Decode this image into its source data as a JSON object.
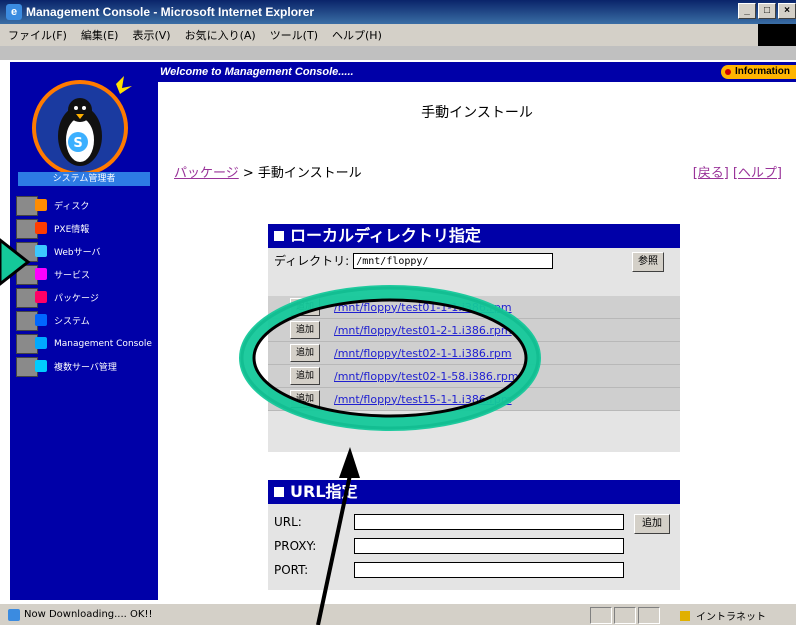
{
  "window": {
    "title": "Management Console - Microsoft Internet Explorer",
    "controls": [
      "_",
      "□",
      "×"
    ]
  },
  "menu": [
    "ファイル(F)",
    "編集(E)",
    "表示(V)",
    "お気に入り(A)",
    "ツール(T)",
    "ヘルプ(H)"
  ],
  "sidebar": {
    "section_label": "システム管理者",
    "items": [
      {
        "label": "ディスク",
        "accent": "#ff8c00"
      },
      {
        "label": "PXE情報",
        "accent": "#ff3c00"
      },
      {
        "label": "Webサーバ",
        "accent": "#3cc8ff"
      },
      {
        "label": "サービス",
        "accent": "#ff00ff"
      },
      {
        "label": "パッケージ",
        "accent": "#ff0066"
      },
      {
        "label": "システム",
        "accent": "#0066ff"
      },
      {
        "label": "Management Console",
        "accent": "#00aaff"
      },
      {
        "label": "複数サーバ管理",
        "accent": "#00ccff"
      }
    ]
  },
  "header": {
    "welcome": "Welcome to Management Console.....",
    "info_label": "Information"
  },
  "page": {
    "title": "手動インストール",
    "breadcrumb_link": "パッケージ",
    "breadcrumb_sep": " > ",
    "breadcrumb_current": "手動インストール",
    "back_link": "[戻る]",
    "help_link": "[ヘルプ]"
  },
  "local_dir": {
    "heading": "ローカルディレクトリ指定",
    "dir_label": "ディレクトリ:",
    "dir_value": "/mnt/floppy/",
    "browse_label": "参照",
    "add_label": "追加",
    "packages": [
      "/mnt/floppy/test01-1-1.i386.rpm",
      "/mnt/floppy/test01-2-1.i386.rpm",
      "/mnt/floppy/test02-1-1.i386.rpm",
      "/mnt/floppy/test02-1-58.i386.rpm",
      "/mnt/floppy/test15-1-1.i386.rpm"
    ]
  },
  "url_spec": {
    "heading": "URL指定",
    "url_label": "URL:",
    "proxy_label": "PROXY:",
    "port_label": "PORT:",
    "add_label": "追加"
  },
  "status": {
    "text": "Now Downloading.... OK!!",
    "zone": "イントラネット"
  },
  "colors": {
    "sidebar_bg": "#0000a8",
    "annotation_fill": "#14c89a",
    "link": "#993399"
  }
}
